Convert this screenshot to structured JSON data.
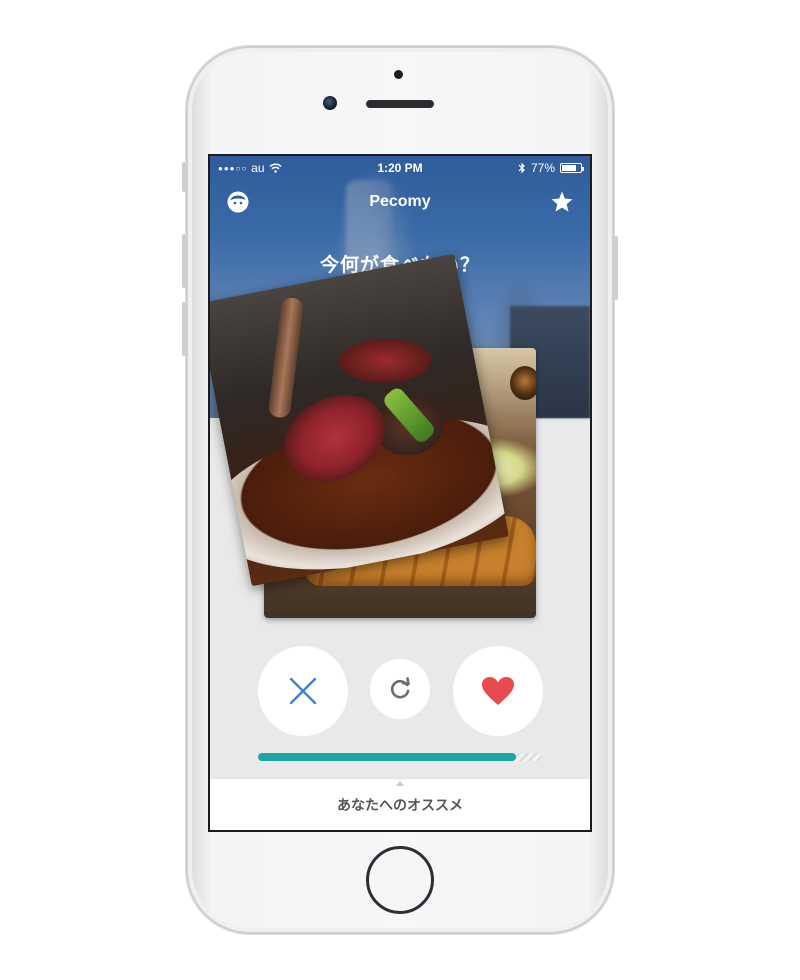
{
  "status_bar": {
    "signal": "●●●○○",
    "carrier": "au",
    "time": "1:20 PM",
    "battery_text": "77%",
    "battery_level": 0.77
  },
  "nav": {
    "title": "Pecomy",
    "profile_icon": "face-icon",
    "favorite_icon": "star-icon"
  },
  "question": "今何が食べたい？",
  "cards": {
    "front": "steak-dish-photo",
    "back": "tonkatsu-set-photo"
  },
  "actions": {
    "nope_icon": "x-icon",
    "refresh_icon": "refresh-icon",
    "like_icon": "heart-icon"
  },
  "progress": {
    "value": 0.91
  },
  "bottom_tab": {
    "label": "あなたへのオススメ"
  },
  "colors": {
    "accent_teal": "#1aa6a2",
    "nope_blue": "#3b82d6",
    "like_red": "#e84a4f",
    "refresh_gray": "#6b6b70"
  }
}
